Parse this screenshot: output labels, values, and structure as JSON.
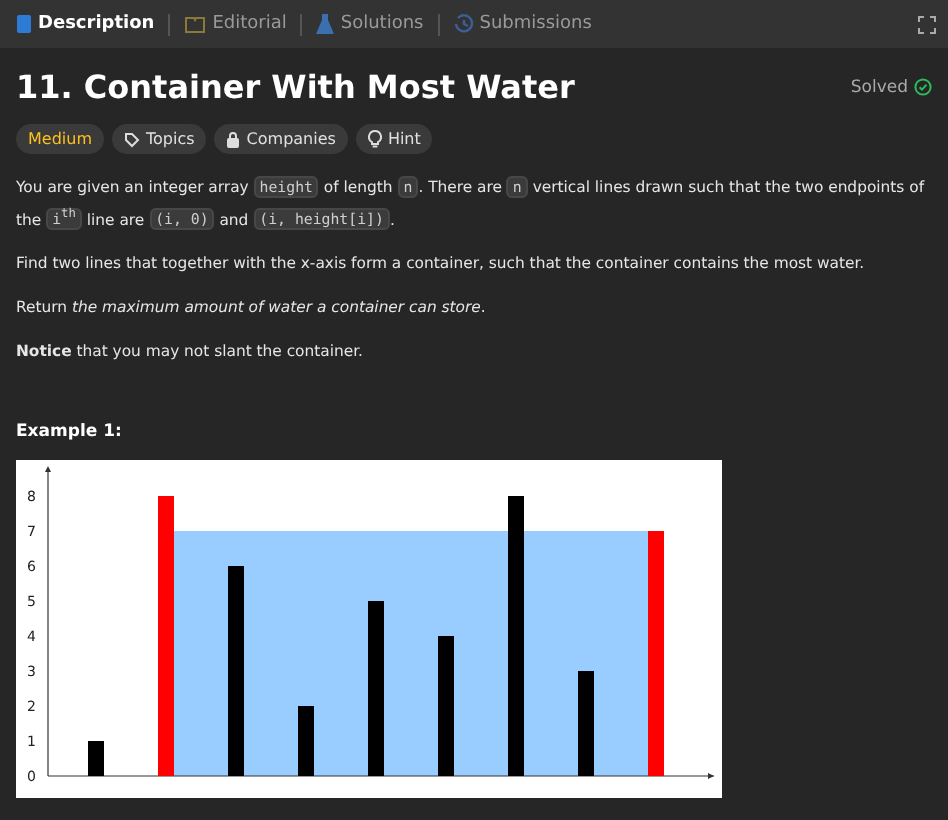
{
  "tabs": [
    {
      "label": "Description",
      "selected": true
    },
    {
      "label": "Editorial",
      "selected": false
    },
    {
      "label": "Solutions",
      "selected": false
    },
    {
      "label": "Submissions",
      "selected": false
    }
  ],
  "title": "11. Container With Most Water",
  "status": {
    "label": "Solved",
    "solved": true
  },
  "tags": [
    {
      "label": "Medium",
      "kind": "difficulty"
    },
    {
      "label": "Topics",
      "kind": "tag"
    },
    {
      "label": "Companies",
      "kind": "lock"
    },
    {
      "label": "Hint",
      "kind": "bulb"
    }
  ],
  "paragraphs": [
    [
      {
        "kind": "text",
        "text": "You are given an integer array "
      },
      {
        "kind": "code",
        "text": "height"
      },
      {
        "kind": "text",
        "text": " of length "
      },
      {
        "kind": "code",
        "text": "n"
      },
      {
        "kind": "text",
        "text": ". There are "
      },
      {
        "kind": "code",
        "text": "n"
      },
      {
        "kind": "text",
        "text": " vertical lines drawn such that the two endpoints of the "
      },
      {
        "kind": "code",
        "text": "i$^{th}$"
      },
      {
        "kind": "text",
        "text": " line are "
      },
      {
        "kind": "code",
        "text": "(i, 0)"
      },
      {
        "kind": "text",
        "text": " and "
      },
      {
        "kind": "code",
        "text": "(i, height[i])"
      },
      {
        "kind": "text",
        "text": "."
      }
    ],
    [
      {
        "kind": "text",
        "text": "Find two lines that together with the x-axis form a container, such that the container contains the most water."
      }
    ],
    [
      {
        "kind": "text",
        "text": "Return "
      },
      {
        "kind": "italic",
        "text": "the maximum amount of water a container can store"
      },
      {
        "kind": "text",
        "text": "."
      }
    ],
    [
      {
        "kind": "bold",
        "text": "Notice"
      },
      {
        "kind": "text",
        "text": " that you may not slant the container."
      }
    ]
  ],
  "example": {
    "heading": "Example 1:",
    "chart_data": {
      "type": "bar",
      "ylim": [
        0,
        8.8
      ],
      "yticks": [
        0,
        1,
        2,
        3,
        4,
        5,
        6,
        7,
        8
      ],
      "series": [
        {
          "color": "#000000",
          "values": [
            1,
            null,
            6,
            2,
            5,
            4,
            8,
            3,
            null
          ]
        },
        {
          "color": "#ff0000",
          "values": [
            null,
            8,
            null,
            null,
            null,
            null,
            null,
            null,
            7
          ]
        }
      ]
    }
  }
}
